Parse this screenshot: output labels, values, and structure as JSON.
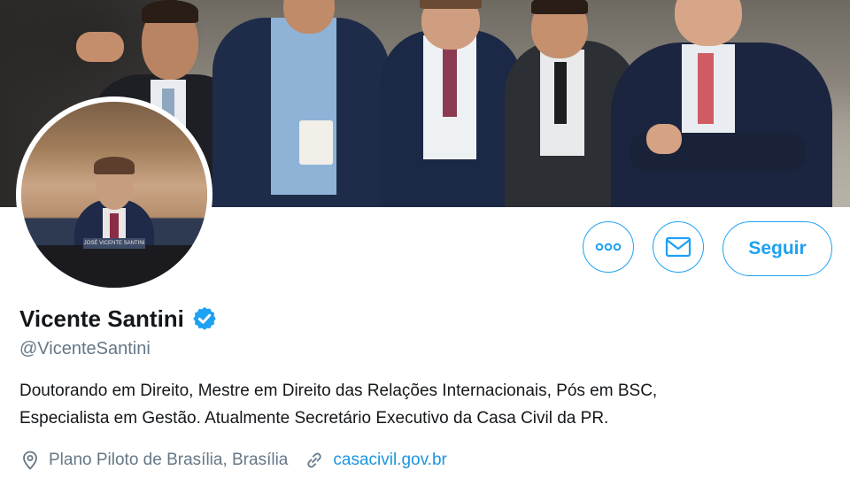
{
  "profile": {
    "name": "Vicente Santini",
    "handle": "@VicenteSantini",
    "verified": true,
    "bio_line1": "Doutorando em Direito, Mestre em Direito das Relações Internacionais, Pós em BSC,",
    "bio_line2": "Especialista em Gestão. Atualmente Secretário Executivo da Casa Civil da PR.",
    "location": "Plano Piloto de Brasília, Brasília",
    "website": "casacivil.gov.br",
    "avatar_nameplate": "JOSÉ VICENTE SANTINI"
  },
  "actions": {
    "more_icon": "more-dots-icon",
    "message_icon": "envelope-icon",
    "follow_label": "Seguir"
  },
  "colors": {
    "accent": "#1da1f2",
    "link": "#1b95e0",
    "secondary_text": "#657786",
    "primary_text": "#14171a"
  }
}
